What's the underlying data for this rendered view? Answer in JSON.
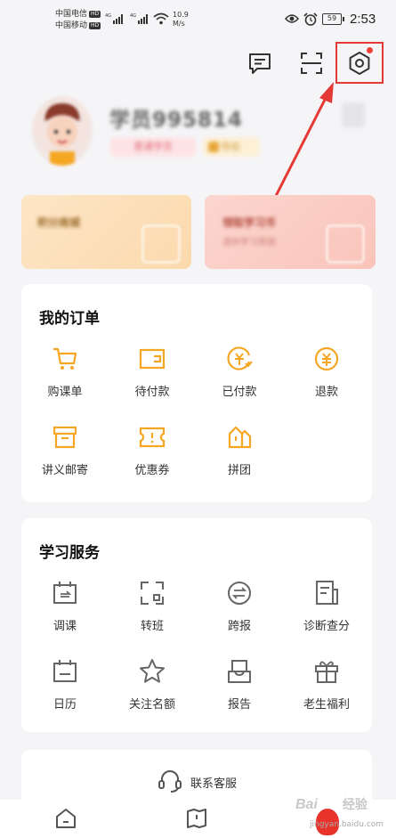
{
  "status_bar": {
    "carrier1": "中国电信",
    "carrier2": "中国移动",
    "hd": "HD",
    "network": "4G",
    "speed_value": "10.9",
    "speed_unit": "M/s",
    "battery": "59",
    "time": "2:53"
  },
  "header": {
    "icons": [
      "message-icon",
      "scan-icon",
      "settings-icon"
    ],
    "settings_has_notification": true
  },
  "profile": {
    "username": "学员995814",
    "badge_primary": "普通学员",
    "badge_secondary": "等级"
  },
  "promos": {
    "left_title": "积分商城",
    "right_title": "领取学习币",
    "right_subtitle": "送你学习奖励"
  },
  "orders": {
    "title": "我的订单",
    "items": [
      {
        "label": "购课单",
        "icon": "cart-icon"
      },
      {
        "label": "待付款",
        "icon": "wallet-icon"
      },
      {
        "label": "已付款",
        "icon": "paid-icon"
      },
      {
        "label": "退款",
        "icon": "refund-icon"
      },
      {
        "label": "讲义邮寄",
        "icon": "package-icon"
      },
      {
        "label": "优惠券",
        "icon": "coupon-icon"
      },
      {
        "label": "拼团",
        "icon": "group-buy-icon"
      }
    ]
  },
  "services": {
    "title": "学习服务",
    "items": [
      {
        "label": "调课",
        "icon": "calendar-adjust-icon"
      },
      {
        "label": "转班",
        "icon": "transfer-icon"
      },
      {
        "label": "跨报",
        "icon": "switch-icon"
      },
      {
        "label": "诊断查分",
        "icon": "report-card-icon"
      },
      {
        "label": "日历",
        "icon": "calendar-icon"
      },
      {
        "label": "关注名额",
        "icon": "star-icon"
      },
      {
        "label": "报告",
        "icon": "inbox-icon"
      },
      {
        "label": "老生福利",
        "icon": "gift-icon"
      }
    ]
  },
  "contact": {
    "label": "联系客服",
    "icon": "headset-icon"
  },
  "tabbar": {
    "icons": [
      "home-icon",
      "book-icon"
    ]
  },
  "watermark": {
    "text": "Bai",
    "sub": "jingyan.baidu.com",
    "mark": "经验"
  },
  "colors": {
    "accent": "#f5a623",
    "highlight": "#e53935",
    "background": "#f5f5f7"
  }
}
